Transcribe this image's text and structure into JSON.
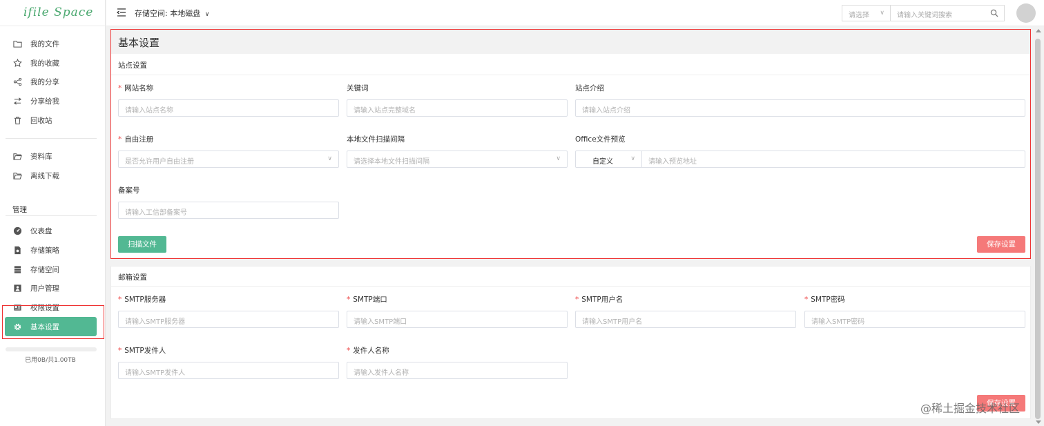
{
  "app": {
    "logo": "ifile Space"
  },
  "topbar": {
    "storage_label": "存储空间:",
    "storage_value": "本地磁盘",
    "search_select_placeholder": "请选择",
    "search_placeholder": "请输入关键词搜索"
  },
  "sidebar": {
    "files": [
      {
        "label": "我的文件",
        "icon": "folder-icon"
      },
      {
        "label": "我的收藏",
        "icon": "star-icon"
      },
      {
        "label": "我的分享",
        "icon": "share-icon"
      },
      {
        "label": "分享给我",
        "icon": "shared-with-me-icon"
      },
      {
        "label": "回收站",
        "icon": "trash-icon"
      }
    ],
    "library": [
      {
        "label": "资料库",
        "icon": "folder-open-icon"
      },
      {
        "label": "离线下载",
        "icon": "folder-open-icon"
      }
    ],
    "manage_title": "管理",
    "manage": [
      {
        "label": "仪表盘",
        "icon": "dashboard-icon"
      },
      {
        "label": "存储策略",
        "icon": "policy-icon"
      },
      {
        "label": "存储空间",
        "icon": "storage-icon"
      },
      {
        "label": "用户管理",
        "icon": "user-icon"
      },
      {
        "label": "权限设置",
        "icon": "permission-icon"
      },
      {
        "label": "基本设置",
        "icon": "gear-icon"
      }
    ],
    "usage": "已用0B/共1.00TB"
  },
  "basic": {
    "title": "基本设置",
    "section": "站点设置",
    "site_name": {
      "label": "网站名称",
      "placeholder": "请输入站点名称"
    },
    "keywords": {
      "label": "关键词",
      "placeholder": "请输入站点完整域名"
    },
    "intro": {
      "label": "站点介绍",
      "placeholder": "请输入站点介绍"
    },
    "register": {
      "label": "自由注册",
      "placeholder": "是否允许用户自由注册"
    },
    "scan": {
      "label": "本地文件扫描间隔",
      "placeholder": "请选择本地文件扫描间隔"
    },
    "office": {
      "label": "Office文件预览",
      "mode": "自定义",
      "placeholder": "请输入预览地址"
    },
    "icp": {
      "label": "备案号",
      "placeholder": "请输入工信部备案号"
    },
    "scan_button": "扫描文件",
    "save_button": "保存设置"
  },
  "mail": {
    "section": "邮箱设置",
    "server": {
      "label": "SMTP服务器",
      "placeholder": "请输入SMTP服务器"
    },
    "port": {
      "label": "SMTP端口",
      "placeholder": "请输入SMTP端口"
    },
    "user": {
      "label": "SMTP用户名",
      "placeholder": "请输入SMTP用户名"
    },
    "password": {
      "label": "SMTP密码",
      "placeholder": "请输入SMTP密码"
    },
    "sender": {
      "label": "SMTP发件人",
      "placeholder": "请输入SMTP发件人"
    },
    "sender_name": {
      "label": "发件人名称",
      "placeholder": "请输入发件人名称"
    },
    "save_button": "保存设置"
  },
  "watermark": "@稀土掘金技术社区",
  "colors": {
    "accent": "#52b893",
    "danger": "#f57979",
    "required": "#e44444",
    "highlight": "#e33333"
  }
}
